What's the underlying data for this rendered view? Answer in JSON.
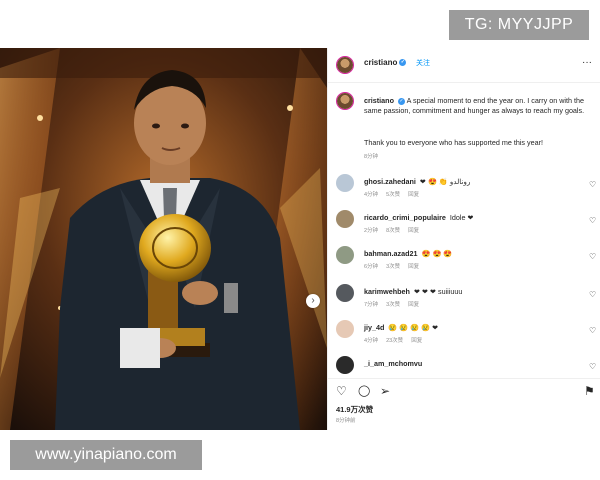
{
  "watermarks": {
    "top": "TG: MYYJJPP",
    "bottom": "www.yinapiano.com"
  },
  "post": {
    "username": "cristiano",
    "follow_label": "关注",
    "more_label": "···",
    "caption": "A special moment to end the year on. I carry on with the same passion, commitment and hunger as always to reach my goals.",
    "thanks": "Thank you to everyone who has supported me this year!",
    "caption_time": "8分钟",
    "likes": "41.9万次赞",
    "post_time": "8分钟前",
    "next_arrow": "›"
  },
  "comments": [
    {
      "user": "ghosi.zahedani",
      "text": "❤ 😍 👏 رونالدو",
      "time": "4分钟",
      "likes": "5次赞",
      "reply": "回复"
    },
    {
      "user": "ricardo_crimi_populaire",
      "text": "Idole ❤",
      "time": "2分钟",
      "likes": "8次赞",
      "reply": "回复"
    },
    {
      "user": "bahman.azad21",
      "text": "😍 😍 😍",
      "time": "6分钟",
      "likes": "3次赞",
      "reply": "回复"
    },
    {
      "user": "karimwehbeh",
      "text": "❤ ❤ ❤ suiiiuuu",
      "time": "7分钟",
      "likes": "3次赞",
      "reply": "回复"
    },
    {
      "user": "jiy_4d",
      "text": "😢 😢 😢 😢 ❤",
      "time": "4分钟",
      "likes": "23次赞",
      "reply": "回复"
    },
    {
      "user": "_i_am_mchomvu",
      "text": "",
      "time": "",
      "likes": "",
      "reply": ""
    }
  ],
  "icons": {
    "heart": "♡",
    "comment": "◯",
    "share": "➢",
    "bookmark": "⚑"
  },
  "colors": {
    "story_ring": "#d6249f",
    "verified": "#3897f0",
    "follow": "#0095f6",
    "meta_gray": "#8e8e8e"
  }
}
